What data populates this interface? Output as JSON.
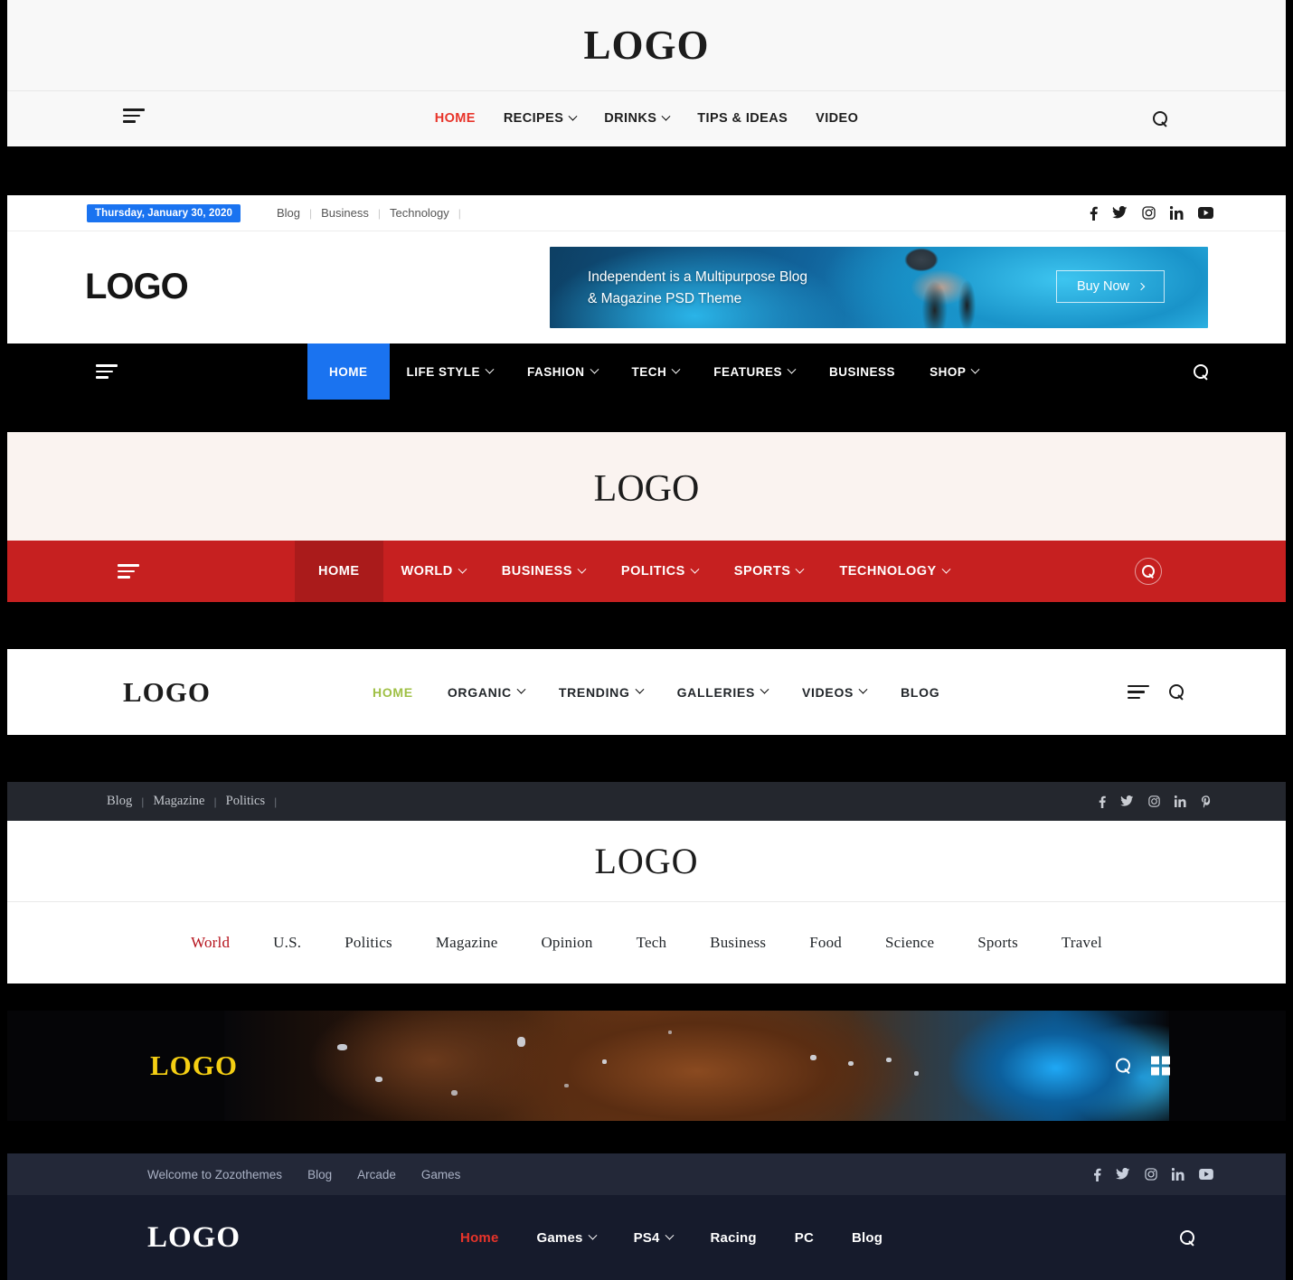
{
  "headers": [
    {
      "id": "recipes-header",
      "logo": "LOGO",
      "menu": [
        {
          "label": "HOME",
          "active": true,
          "caret": false
        },
        {
          "label": "RECIPES",
          "active": false,
          "caret": true
        },
        {
          "label": "DRINKS",
          "active": false,
          "caret": true
        },
        {
          "label": "TIPS & IDEAS",
          "active": false,
          "caret": false
        },
        {
          "label": "VIDEO",
          "active": false,
          "caret": false
        }
      ],
      "accent": "#e8342a",
      "background": "#f8f8f8"
    },
    {
      "id": "independent-header",
      "logo": "LOGO",
      "date": "Thursday, January 30, 2020",
      "top_links": [
        "Blog",
        "Business",
        "Technology"
      ],
      "social": [
        "facebook-icon",
        "twitter-icon",
        "instagram-icon",
        "linkedin-icon",
        "youtube-icon"
      ],
      "banner": {
        "line1": "Independent is a Multipurpose Blog",
        "line2": "& Magazine PSD Theme",
        "button": "Buy Now"
      },
      "menu": [
        {
          "label": "HOME",
          "active": true,
          "caret": false
        },
        {
          "label": "LIFE STYLE",
          "active": false,
          "caret": true
        },
        {
          "label": "FASHION",
          "active": false,
          "caret": true
        },
        {
          "label": "TECH",
          "active": false,
          "caret": true
        },
        {
          "label": "FEATURES",
          "active": false,
          "caret": true
        },
        {
          "label": "BUSINESS",
          "active": false,
          "caret": false
        },
        {
          "label": "SHOP",
          "active": false,
          "caret": true
        }
      ],
      "accent": "#1a73f0",
      "nav_background": "#000000"
    },
    {
      "id": "red-news-header",
      "logo": "LOGO",
      "menu": [
        {
          "label": "HOME",
          "active": true,
          "caret": false
        },
        {
          "label": "WORLD",
          "active": false,
          "caret": true
        },
        {
          "label": "BUSINESS",
          "active": false,
          "caret": true
        },
        {
          "label": "POLITICS",
          "active": false,
          "caret": true
        },
        {
          "label": "SPORTS",
          "active": false,
          "caret": true
        },
        {
          "label": "TECHNOLOGY",
          "active": false,
          "caret": true
        }
      ],
      "accent": "#c62020",
      "logo_background": "#faf3f0"
    },
    {
      "id": "organic-header",
      "logo": "LOGO",
      "menu": [
        {
          "label": "HOME",
          "active": true,
          "caret": false
        },
        {
          "label": "ORGANIC",
          "active": false,
          "caret": true
        },
        {
          "label": "TRENDING",
          "active": false,
          "caret": true
        },
        {
          "label": "GALLERIES",
          "active": false,
          "caret": true
        },
        {
          "label": "VIDEOS",
          "active": false,
          "caret": true
        },
        {
          "label": "BLOG",
          "active": false,
          "caret": false
        }
      ],
      "accent": "#9fc045",
      "background": "#ffffff"
    },
    {
      "id": "magazine-header",
      "logo": "LOGO",
      "top_links": [
        "Blog",
        "Magazine",
        "Politics"
      ],
      "social": [
        "facebook-icon",
        "twitter-icon",
        "instagram-icon",
        "linkedin-icon",
        "pinterest-icon"
      ],
      "menu": [
        {
          "label": "World",
          "active": true
        },
        {
          "label": "U.S.",
          "active": false
        },
        {
          "label": "Politics",
          "active": false
        },
        {
          "label": "Magazine",
          "active": false
        },
        {
          "label": "Opinion",
          "active": false
        },
        {
          "label": "Tech",
          "active": false
        },
        {
          "label": "Business",
          "active": false
        },
        {
          "label": "Food",
          "active": false
        },
        {
          "label": "Science",
          "active": false
        },
        {
          "label": "Sports",
          "active": false
        },
        {
          "label": "Travel",
          "active": false
        }
      ],
      "accent": "#b5121b",
      "topbar_background": "#24272e"
    },
    {
      "id": "dark-banner-header",
      "logo": "LOGO",
      "logo_color": "#f5cf13",
      "icons": [
        "search-icon",
        "grid-icon"
      ]
    },
    {
      "id": "gaming-header",
      "logo": "LOGO",
      "top_links": [
        "Welcome to Zozothemes",
        "Blog",
        "Arcade",
        "Games"
      ],
      "social": [
        "facebook-icon",
        "twitter-icon",
        "instagram-icon",
        "linkedin-icon",
        "youtube-icon"
      ],
      "menu": [
        {
          "label": "Home",
          "active": true,
          "caret": false
        },
        {
          "label": "Games",
          "active": false,
          "caret": true
        },
        {
          "label": "PS4",
          "active": false,
          "caret": true
        },
        {
          "label": "Racing",
          "active": false,
          "caret": false
        },
        {
          "label": "PC",
          "active": false,
          "caret": false
        },
        {
          "label": "Blog",
          "active": false,
          "caret": false
        }
      ],
      "accent": "#e8342a",
      "topbar_background": "#232838",
      "nav_background": "#161b2c"
    }
  ]
}
